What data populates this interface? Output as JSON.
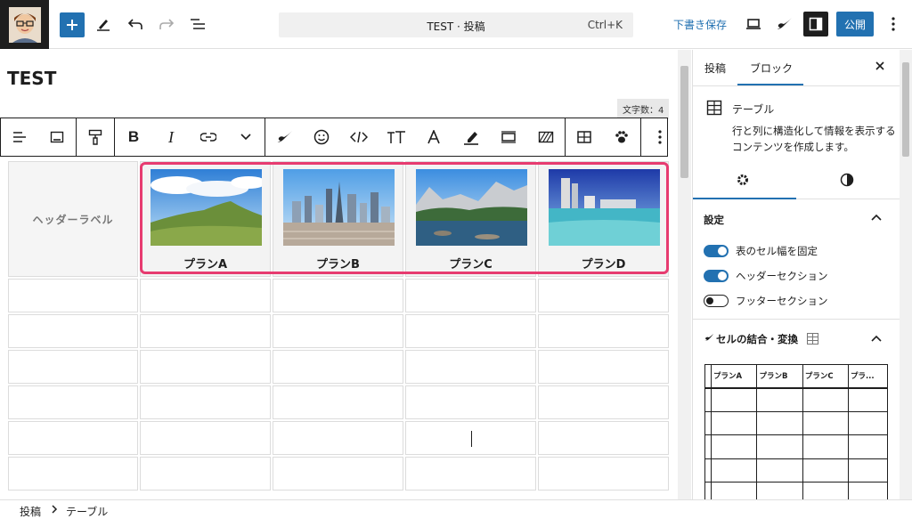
{
  "topbar": {
    "command_title": "TEST · 投稿",
    "command_shortcut": "Ctrl+K",
    "save_draft": "下書き保存",
    "publish": "公開"
  },
  "editor": {
    "post_title": "TEST",
    "char_count": "文字数：4",
    "table": {
      "header_label": "ヘッダーラベル",
      "plans": [
        "プランA",
        "プランB",
        "プランC",
        "プランD"
      ]
    }
  },
  "sidebar": {
    "tabs": [
      "投稿",
      "ブロック"
    ],
    "active_tab": "ブロック",
    "block_title": "テーブル",
    "block_desc": "行と列に構造化して情報を表示するコンテンツを作成します。",
    "settings_title": "設定",
    "toggles": [
      {
        "label": "表のセル幅を固定",
        "on": true
      },
      {
        "label": "ヘッダーセクション",
        "on": true
      },
      {
        "label": "フッターセクション",
        "on": false
      }
    ],
    "merge_title": "セルの結合・変換",
    "mini_table_headers": [
      "",
      "プランA",
      "プランB",
      "プランC",
      "プラ..."
    ]
  },
  "footer": {
    "crumbs": [
      "投稿",
      "テーブル"
    ]
  },
  "colors": {
    "accent": "#2271b1",
    "highlight": "#e73b70"
  }
}
